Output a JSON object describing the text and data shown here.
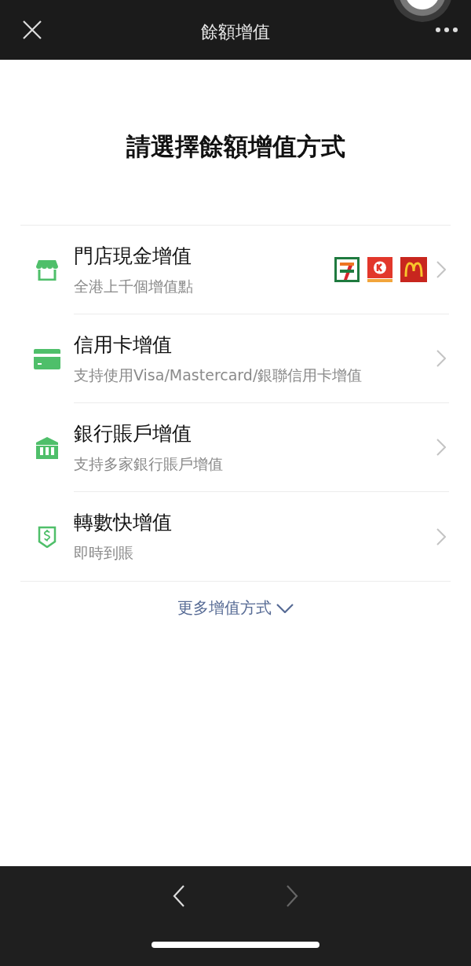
{
  "top_bar": {
    "title": "餘額增值"
  },
  "heading": "請選擇餘額增值方式",
  "methods": [
    {
      "kind": "store",
      "title": "門店現金增值",
      "subtitle": "全港上千個增值點",
      "partner_logos": true
    },
    {
      "kind": "card",
      "title": "信用卡增值",
      "subtitle": "支持使用Visa/Mastercard/銀聯信用卡增值",
      "partner_logos": false
    },
    {
      "kind": "bank",
      "title": "銀行賬戶增值",
      "subtitle": "支持多家銀行賬戶增值",
      "partner_logos": false
    },
    {
      "kind": "transfer",
      "title": "轉數快增值",
      "subtitle": "即時到賬",
      "partner_logos": false
    }
  ],
  "more_link": "更多增值方式",
  "bottom_nav": {
    "back": {
      "disabled": false
    },
    "forward": {
      "disabled": true
    }
  }
}
